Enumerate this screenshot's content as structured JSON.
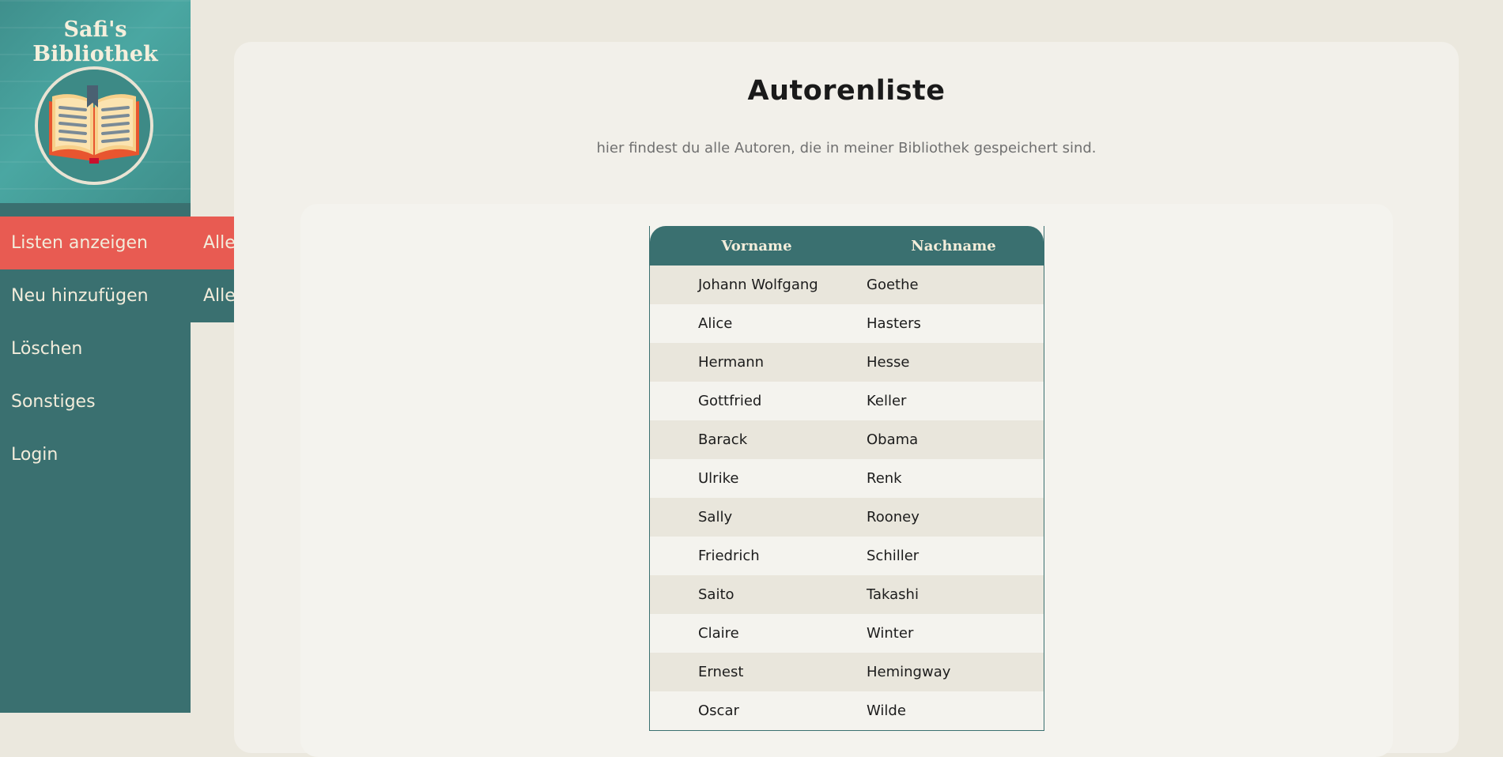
{
  "sidebar": {
    "title": "Safi's Bibliothek",
    "nav": [
      {
        "label": "Listen anzeigen",
        "active": true
      },
      {
        "label": "Neu hinzufügen",
        "active": false
      },
      {
        "label": "Löschen",
        "active": false
      },
      {
        "label": "Sonstiges",
        "active": false
      },
      {
        "label": "Login",
        "active": false
      }
    ],
    "submenu": [
      {
        "label": "Alle Autoren",
        "active": true
      },
      {
        "label": "Alle Bücher",
        "active": false
      }
    ]
  },
  "main": {
    "title": "Autorenliste",
    "subtitle": "hier findest du alle Autoren, die in meiner Bibliothek gespeichert sind.",
    "table": {
      "headers": [
        "Vorname",
        "Nachname"
      ],
      "rows": [
        [
          "Johann Wolfgang",
          "Goethe"
        ],
        [
          "Alice",
          "Hasters"
        ],
        [
          "Hermann",
          "Hesse"
        ],
        [
          "Gottfried",
          "Keller"
        ],
        [
          "Barack",
          "Obama"
        ],
        [
          "Ulrike",
          "Renk"
        ],
        [
          "Sally",
          "Rooney"
        ],
        [
          "Friedrich",
          "Schiller"
        ],
        [
          "Saito",
          "Takashi"
        ],
        [
          "Claire",
          "Winter"
        ],
        [
          "Ernest",
          "Hemingway"
        ],
        [
          "Oscar",
          "Wilde"
        ]
      ]
    }
  },
  "colors": {
    "sidebar": "#3a7070",
    "accent": "#e85b52",
    "background": "#ebe8de",
    "card": "#f2f0ea"
  },
  "icons": {
    "logo": "open-book-icon"
  }
}
